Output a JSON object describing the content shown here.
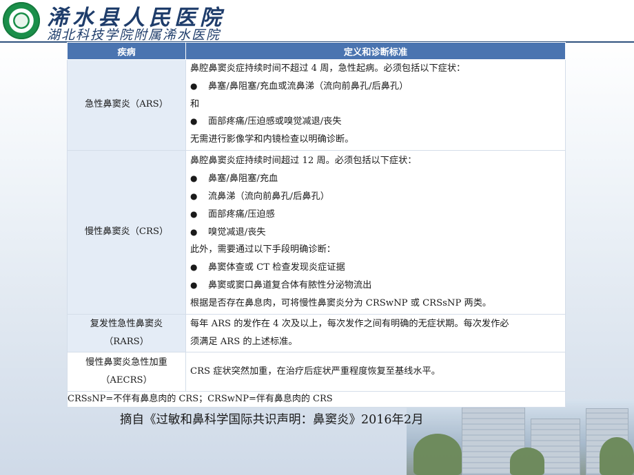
{
  "header": {
    "hospital_name": "浠水县人民医院",
    "affiliation": "湖北科技学院附属浠水医院"
  },
  "table": {
    "col_disease": "疾病",
    "col_definition": "定义和诊断标准",
    "rows": [
      {
        "disease": "急性鼻窦炎（ARS）",
        "lines": [
          {
            "bullet": "",
            "text": "鼻腔鼻窦炎症持续时间不超过 4 周，急性起病。必须包括以下症状："
          },
          {
            "bullet": "●",
            "text": "鼻塞/鼻阻塞/充血或流鼻涕（流向前鼻孔/后鼻孔）"
          },
          {
            "bullet": "",
            "text": "和"
          },
          {
            "bullet": "●",
            "text": "面部疼痛/压迫感或嗅觉减退/丧失"
          },
          {
            "bullet": "",
            "text": "无需进行影像学和内镜检查以明确诊断。"
          }
        ]
      },
      {
        "disease": "慢性鼻窦炎（CRS）",
        "lines": [
          {
            "bullet": "",
            "text": "鼻腔鼻窦炎症持续时间超过 12 周。必须包括以下症状："
          },
          {
            "bullet": "●",
            "text": "鼻塞/鼻阻塞/充血"
          },
          {
            "bullet": "●",
            "text": "流鼻涕（流向前鼻孔/后鼻孔）"
          },
          {
            "bullet": "●",
            "text": "面部疼痛/压迫感"
          },
          {
            "bullet": "●",
            "text": "嗅觉减退/丧失"
          },
          {
            "bullet": "",
            "text": "此外，需要通过以下手段明确诊断："
          },
          {
            "bullet": "●",
            "text": "鼻窦体查或 CT 检查发现炎症证据"
          },
          {
            "bullet": "●",
            "text": "鼻窦或窦口鼻道复合体有脓性分泌物流出"
          },
          {
            "bullet": "",
            "text": "根据是否存在鼻息肉，可将慢性鼻窦炎分为 CRSwNP 或 CRSsNP 两类。"
          }
        ]
      },
      {
        "disease_line1": "复发性急性鼻窦炎",
        "disease_line2": "（RARS）",
        "lines": [
          {
            "bullet": "",
            "text": "每年 ARS 的发作在 4 次及以上，每次发作之间有明确的无症状期。每次发作必"
          },
          {
            "bullet": "",
            "text": "须满足 ARS 的上述标准。"
          }
        ]
      },
      {
        "disease_line1": "慢性鼻窦炎急性加重",
        "disease_line2": "（AECRS）",
        "lines": [
          {
            "bullet": "",
            "text": "CRS 症状突然加重，在治疗后症状严重程度恢复至基线水平。"
          }
        ]
      }
    ],
    "note": "CRSsNP=不伴有鼻息肉的 CRS；CRSwNP=伴有鼻息肉的 CRS"
  },
  "source": "摘自《过敏和鼻科学国际共识声明：鼻窦炎》2016年2月"
}
